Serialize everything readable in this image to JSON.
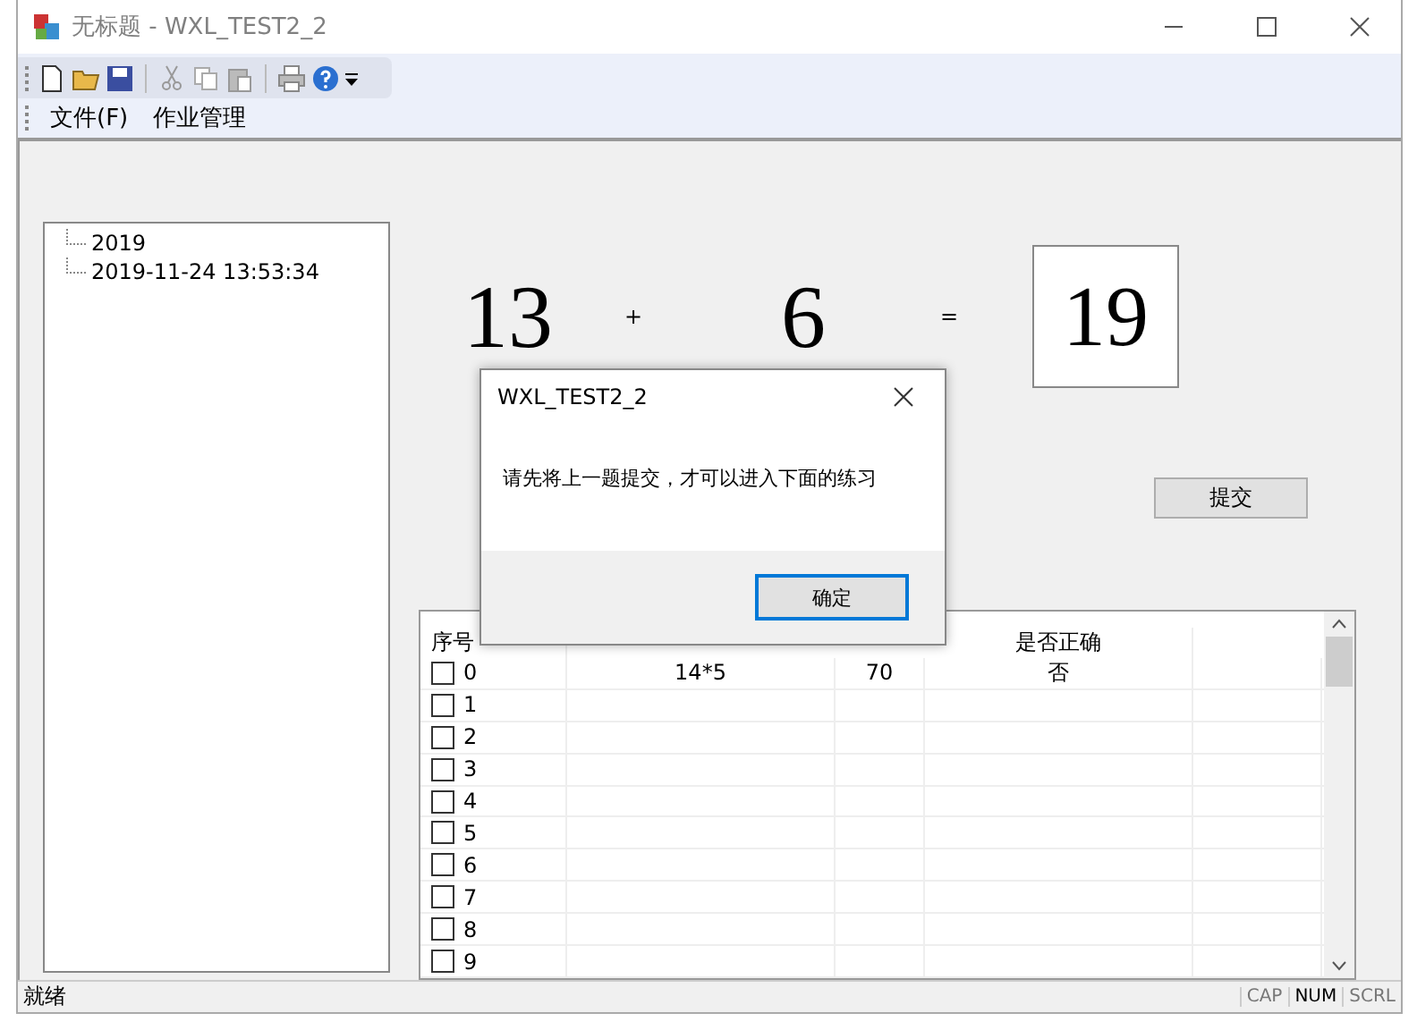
{
  "window": {
    "title": "无标题 - WXL_TEST2_2"
  },
  "menu": [
    {
      "label": "文件(F)"
    },
    {
      "label": "作业管理"
    }
  ],
  "tree": [
    {
      "label": "2019"
    },
    {
      "label": "2019-11-24 13:53:34"
    }
  ],
  "equation": {
    "operand_1": "13",
    "operator": "+",
    "operand_2": "6",
    "equals": "=",
    "answer": "19"
  },
  "submit_button": "提交",
  "table": {
    "columns": [
      "序号",
      "",
      "",
      "是否正确",
      ""
    ],
    "rows": [
      {
        "cells": [
          "0",
          "14*5",
          "70",
          "否",
          ""
        ],
        "checked": false
      },
      {
        "cells": [
          "1",
          "",
          "",
          "",
          ""
        ],
        "checked": false
      },
      {
        "cells": [
          "2",
          "",
          "",
          "",
          ""
        ],
        "checked": false
      },
      {
        "cells": [
          "3",
          "",
          "",
          "",
          ""
        ],
        "checked": false
      },
      {
        "cells": [
          "4",
          "",
          "",
          "",
          ""
        ],
        "checked": false
      },
      {
        "cells": [
          "5",
          "",
          "",
          "",
          ""
        ],
        "checked": false
      },
      {
        "cells": [
          "6",
          "",
          "",
          "",
          ""
        ],
        "checked": false
      },
      {
        "cells": [
          "7",
          "",
          "",
          "",
          ""
        ],
        "checked": false
      },
      {
        "cells": [
          "8",
          "",
          "",
          "",
          ""
        ],
        "checked": false
      },
      {
        "cells": [
          "9",
          "",
          "",
          "",
          ""
        ],
        "checked": false
      }
    ]
  },
  "dialog": {
    "title": "WXL_TEST2_2",
    "message": "请先将上一题提交，才可以进入下面的练习",
    "button": "确定"
  },
  "status_bar": {
    "text": "就绪",
    "indicators": [
      {
        "label": "CAP",
        "on": false
      },
      {
        "label": "NUM",
        "on": true
      },
      {
        "label": "SCRL",
        "on": false
      }
    ]
  }
}
